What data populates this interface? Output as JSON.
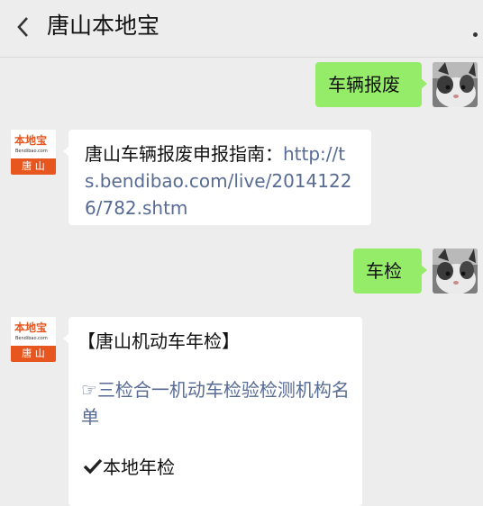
{
  "header": {
    "title": "唐山本地宝"
  },
  "messages": {
    "m1": {
      "text": "车辆报废"
    },
    "m2": {
      "prefix": "唐山车辆报废申报指南：",
      "link": "http://ts.bendibao.com/live/20141226/782.shtm"
    },
    "m3": {
      "text": "车检"
    },
    "m4": {
      "heading": "【唐山机动车年检】",
      "link_icon": "☞",
      "link_text": "三检合一机动车检验检测机构名单",
      "check_text": "本地年检"
    }
  },
  "logo": {
    "top": "本地宝",
    "mid": "Bendibao.com",
    "bottom": "唐 山",
    "brand_color": "#e8561f"
  },
  "colors": {
    "green_bubble": "#95ec69",
    "link": "#576b95",
    "background": "#ededed"
  }
}
